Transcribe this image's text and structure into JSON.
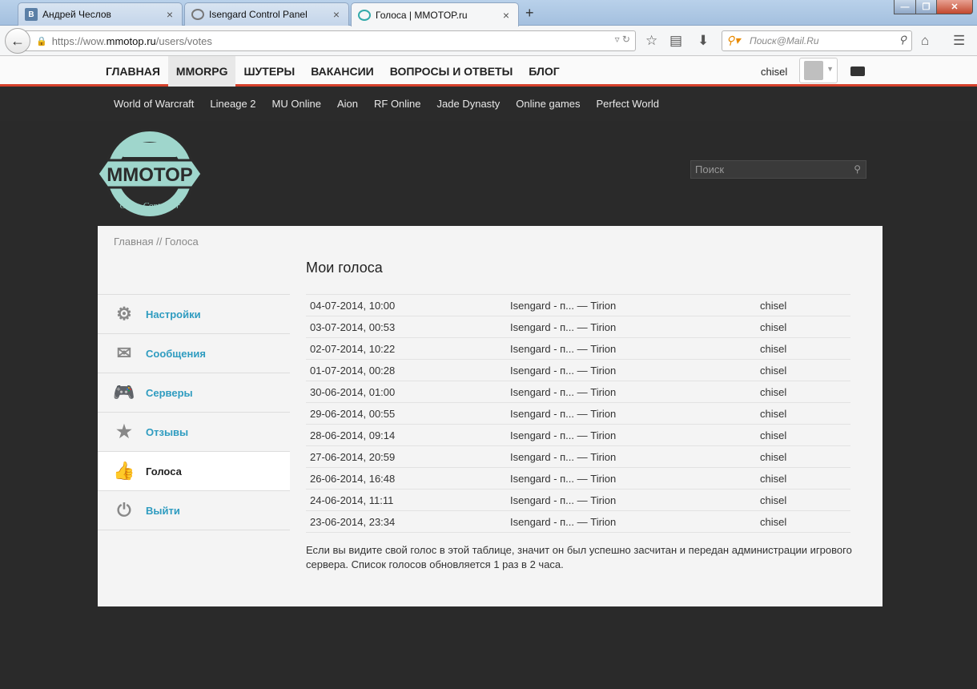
{
  "browser": {
    "tabs": [
      {
        "label": "Андрей Чеслов",
        "favicon": "В"
      },
      {
        "label": "Isengard Control Panel",
        "favicon": ""
      },
      {
        "label": "Голоса | MMOTOP.ru",
        "favicon": ""
      }
    ],
    "url_prefix": "https://wow.",
    "url_host": "mmotop.ru",
    "url_path": "/users/votes",
    "search_placeholder": "Поиск@Mail.Ru"
  },
  "site": {
    "top_menu": [
      "ГЛАВНАЯ",
      "MMORPG",
      "ШУТЕРЫ",
      "ВАКАНСИИ",
      "ВОПРОСЫ И ОТВЕТЫ",
      "БЛОГ"
    ],
    "active_menu": "MMORPG",
    "username": "chisel",
    "games": [
      "World of Warcraft",
      "Lineage 2",
      "MU Online",
      "Aion",
      "RF Online",
      "Jade Dynasty",
      "Online games",
      "Perfect World"
    ],
    "logo_text": "MMOTOP",
    "logo_subtext": "Game Controller",
    "search_placeholder": "Поиск",
    "accent_color": "#d6412b",
    "link_color": "#2f9cc0"
  },
  "breadcrumb": "Главная // Голоса",
  "sidebar": [
    {
      "label": "Настройки",
      "icon": "gear-icon"
    },
    {
      "label": "Сообщения",
      "icon": "envelope-icon"
    },
    {
      "label": "Серверы",
      "icon": "gamepad-icon"
    },
    {
      "label": "Отзывы",
      "icon": "star-icon"
    },
    {
      "label": "Голоса",
      "icon": "thumbs-up-icon",
      "active": true
    },
    {
      "label": "Выйти",
      "icon": "power-icon"
    }
  ],
  "page_title": "Мои голоса",
  "votes": [
    {
      "date": "04-07-2014, 10:00",
      "server": "Isengard - п... — Tirion",
      "user": "chisel"
    },
    {
      "date": "03-07-2014, 00:53",
      "server": "Isengard - п... — Tirion",
      "user": "chisel"
    },
    {
      "date": "02-07-2014, 10:22",
      "server": "Isengard - п... — Tirion",
      "user": "chisel"
    },
    {
      "date": "01-07-2014, 00:28",
      "server": "Isengard - п... — Tirion",
      "user": "chisel"
    },
    {
      "date": "30-06-2014, 01:00",
      "server": "Isengard - п... — Tirion",
      "user": "chisel"
    },
    {
      "date": "29-06-2014, 00:55",
      "server": "Isengard - п... — Tirion",
      "user": "chisel"
    },
    {
      "date": "28-06-2014, 09:14",
      "server": "Isengard - п... — Tirion",
      "user": "chisel"
    },
    {
      "date": "27-06-2014, 20:59",
      "server": "Isengard - п... — Tirion",
      "user": "chisel"
    },
    {
      "date": "26-06-2014, 16:48",
      "server": "Isengard - п... — Tirion",
      "user": "chisel"
    },
    {
      "date": "24-06-2014, 11:11",
      "server": "Isengard - п... — Tirion",
      "user": "chisel"
    },
    {
      "date": "23-06-2014, 23:34",
      "server": "Isengard - п... — Tirion",
      "user": "chisel"
    }
  ],
  "note": "Если вы видите свой голос в этой таблице, значит он был успешно засчитан и передан администрации игрового сервера. Список голосов обновляется 1 раз в 2 часа."
}
